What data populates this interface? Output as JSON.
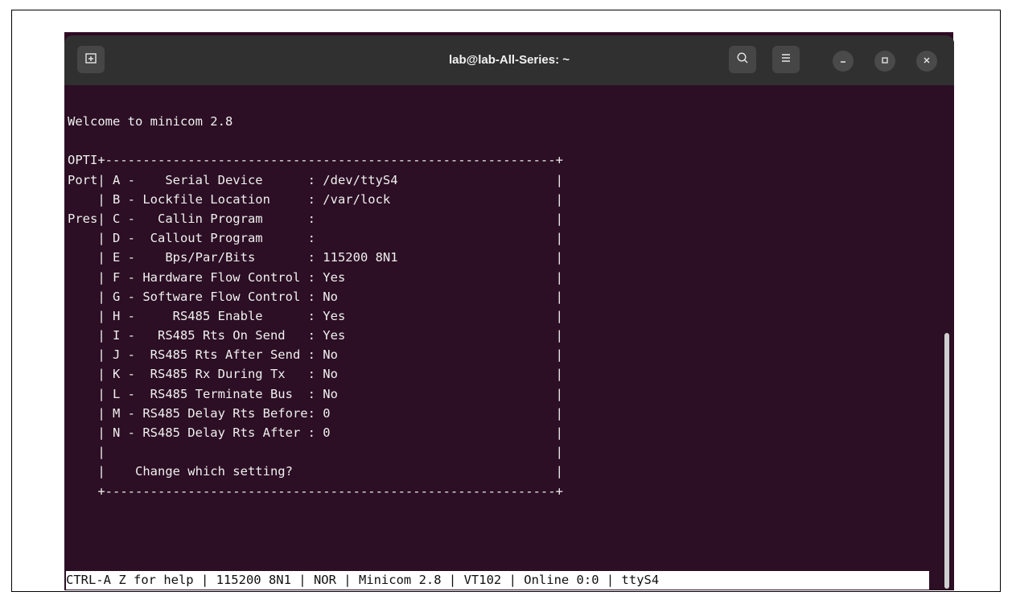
{
  "window": {
    "title": "lab@lab-All-Series: ~",
    "new_tab_icon": "new-tab-icon",
    "search_icon": "search-icon",
    "menu_icon": "hamburger-menu-icon",
    "minimize_icon": "minimize-icon",
    "maximize_icon": "maximize-icon",
    "close_icon": "close-icon"
  },
  "terminal": {
    "lines": [
      "Welcome to minicom 2.8",
      "",
      "OPTI+------------------------------------------------------------+",
      "Port| A -    Serial Device      : /dev/ttyS4                     |",
      "    | B - Lockfile Location     : /var/lock                      |",
      "Pres| C -   Callin Program      :                                |",
      "    | D -  Callout Program      :                                |",
      "    | E -    Bps/Par/Bits       : 115200 8N1                     |",
      "    | F - Hardware Flow Control : Yes                            |",
      "    | G - Software Flow Control : No                             |",
      "    | H -     RS485 Enable      : Yes                            |",
      "    | I -   RS485 Rts On Send   : Yes                            |",
      "    | J -  RS485 Rts After Send : No                             |",
      "    | K -  RS485 Rx During Tx   : No                             |",
      "    | L -  RS485 Terminate Bus  : No                             |",
      "    | M - RS485 Delay Rts Before: 0                              |",
      "    | N - RS485 Delay Rts After : 0                              |",
      "    |                                                            |",
      "    |    Change which setting?                                   |",
      "    +------------------------------------------------------------+"
    ],
    "status_bar": "CTRL-A Z for help | 115200 8N1 | NOR | Minicom 2.8 | VT102 | Online 0:0 | ttyS4"
  },
  "colors": {
    "terminal_bg": "#2c0f24",
    "header_bg": "#303030",
    "text": "#f0f0f0",
    "status_bg": "#ffffff"
  }
}
